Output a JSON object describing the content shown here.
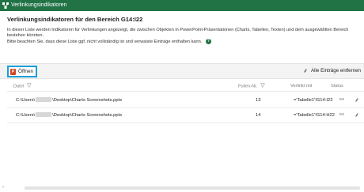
{
  "window": {
    "title": "Verlinkungsindikatoren"
  },
  "heading": "Verlinkungsindikatoren für den Bereich G14:I22",
  "description": {
    "line1": "In dieser Liste werden Indikatoren für Verlinkungen angezeigt, die zwischen Objekten in PowerPoint-Präsentationen (Charts, Tabellen, Texten) und dem ausgewählten Bereich bestehen könnten.",
    "line2": "Bitte beachten Sie, dass diese Liste ggf. nicht vollständig ist und verwaiste Einträge enthalten kann."
  },
  "toolbar": {
    "open_label": "Öffnen",
    "remove_all_label": "Alle Einträge entfernen"
  },
  "table": {
    "headers": {
      "file": "Datei",
      "slide": "Folien-Nr.",
      "linked": "Verlinkt mit",
      "status": "Status"
    },
    "rows": [
      {
        "path_prefix": "C:\\Users\\",
        "path_suffix": "\\Desktop\\Charts Screenshots.pptx",
        "slide": "13",
        "linked": "='Tabelle1'!G14:I22"
      },
      {
        "path_prefix": "C:\\Users\\",
        "path_suffix": "\\Desktop\\Charts Screenshots.pptx",
        "slide": "14",
        "linked": "='Tabelle1'!G14:H22"
      }
    ]
  },
  "colors": {
    "title_bar": "#217346",
    "focus_ring": "#1a9fd9",
    "powerpoint": "#d24726"
  },
  "icons": {
    "app": "excel-app-icon",
    "help": "help-icon",
    "filter": "filter-icon",
    "broom": "broom-icon",
    "link": "link-icon"
  }
}
